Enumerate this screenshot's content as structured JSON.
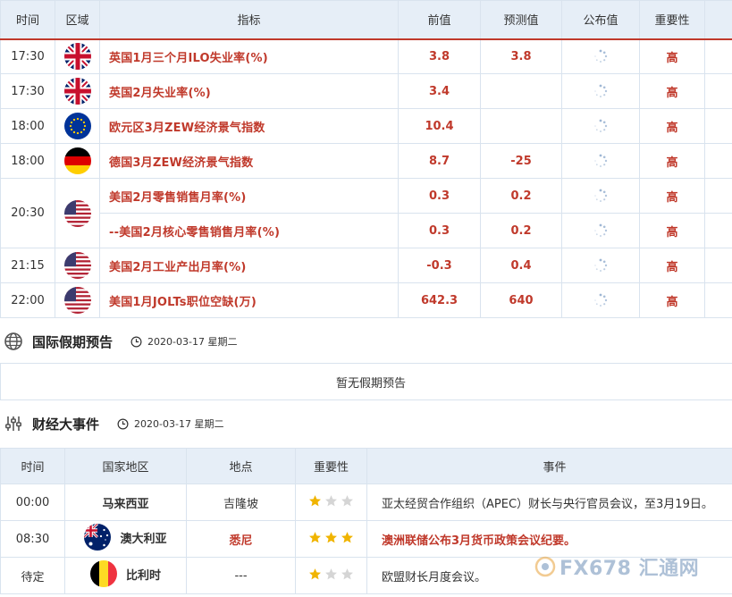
{
  "data_table": {
    "headers": {
      "time": "时间",
      "region": "区域",
      "indicator": "指标",
      "previous": "前值",
      "forecast": "预测值",
      "published": "公布值",
      "importance": "重要性"
    },
    "rows": [
      {
        "time": "17:30",
        "flag": "uk-flag-icon",
        "indicator": "英国1月三个月ILO失业率(%)",
        "previous": "3.8",
        "forecast": "3.8",
        "importance": "高"
      },
      {
        "time": "17:30",
        "flag": "uk-flag-icon",
        "indicator": "英国2月失业率(%)",
        "previous": "3.4",
        "forecast": "",
        "importance": "高"
      },
      {
        "time": "18:00",
        "flag": "eu-flag-icon",
        "indicator": "欧元区3月ZEW经济景气指数",
        "previous": "10.4",
        "forecast": "",
        "importance": "高"
      },
      {
        "time": "18:00",
        "flag": "germany-flag-icon",
        "indicator": "德国3月ZEW经济景气指数",
        "previous": "8.7",
        "forecast": "-25",
        "importance": "高"
      },
      {
        "time": "20:30",
        "flag": "us-flag-icon",
        "indicator": "美国2月零售销售月率(%)",
        "previous": "0.3",
        "forecast": "0.2",
        "importance": "高"
      },
      {
        "time": "",
        "flag": "",
        "indicator": "--美国2月核心零售销售月率(%)",
        "previous": "0.3",
        "forecast": "0.2",
        "importance": "高"
      },
      {
        "time": "21:15",
        "flag": "us-flag-icon",
        "indicator": "美国2月工业产出月率(%)",
        "previous": "-0.3",
        "forecast": "0.4",
        "importance": "高"
      },
      {
        "time": "22:00",
        "flag": "us-flag-icon",
        "indicator": "美国1月JOLTs职位空缺(万)",
        "previous": "642.3",
        "forecast": "640",
        "importance": "高"
      }
    ]
  },
  "holidays": {
    "title": "国际假期预告",
    "date": "2020-03-17 星期二",
    "empty_message": "暂无假期预告"
  },
  "events": {
    "title": "财经大事件",
    "date": "2020-03-17 星期二",
    "headers": {
      "time": "时间",
      "country": "国家地区",
      "place": "地点",
      "importance": "重要性",
      "event": "事件"
    },
    "rows": [
      {
        "time": "00:00",
        "country": "马来西亚",
        "place": "吉隆坡",
        "stars": 1,
        "event": "亚太经贸合作组织（APEC）财长与央行官员会议，至3月19日。"
      },
      {
        "time": "08:30",
        "country": "澳大利亚",
        "place": "悉尼",
        "stars": 3,
        "event": "澳洲联储公布3月货币政策会议纪要。"
      },
      {
        "time": "待定",
        "country": "比利时",
        "place": "---",
        "stars": 1,
        "event": "欧盟财长月度会议。"
      }
    ]
  },
  "watermark": {
    "text": "FX678 汇通网"
  },
  "colors": {
    "accent_red": "#c0392b",
    "header_bg": "#e6eef7",
    "border": "#d9e3ee",
    "star_gold": "#f0b400",
    "star_grey": "#d5d5d5"
  }
}
